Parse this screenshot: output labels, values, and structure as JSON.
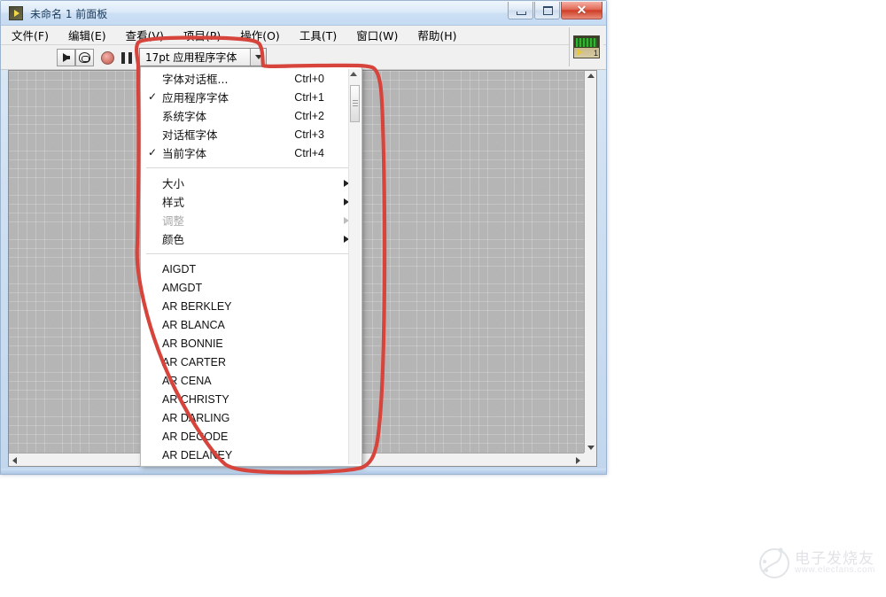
{
  "window": {
    "title": "未命名 1 前面板",
    "app_icon": "labview-vi-icon",
    "controls": {
      "minimize": "–",
      "maximize": "□",
      "close": "✕"
    }
  },
  "menubar": {
    "items": [
      {
        "label": "文件(F)",
        "name": "menu-file"
      },
      {
        "label": "编辑(E)",
        "name": "menu-edit"
      },
      {
        "label": "查看(V)",
        "name": "menu-view"
      },
      {
        "label": "项目(P)",
        "name": "menu-project"
      },
      {
        "label": "操作(O)",
        "name": "menu-operate"
      },
      {
        "label": "工具(T)",
        "name": "menu-tools"
      },
      {
        "label": "窗口(W)",
        "name": "menu-window"
      },
      {
        "label": "帮助(H)",
        "name": "menu-help"
      }
    ]
  },
  "toolbar": {
    "run_icon": "run-arrow-icon",
    "run_continuous_icon": "run-continuously-icon",
    "abort_icon": "abort-execution-icon",
    "pause_icon": "pause-icon",
    "font_combo_value": "17pt 应用程序字体",
    "align_icon": "align-objects-icon",
    "distribute_icon": "distribute-objects-icon",
    "resize_icon": "resize-objects-icon",
    "reorder_icon": "reorder-objects-icon",
    "help_icon": "context-help-icon",
    "vi_icon_number": "1"
  },
  "font_menu": {
    "commands": [
      {
        "label": "字体对话框...",
        "accel": "Ctrl+0",
        "checked": false,
        "disabled": false
      },
      {
        "label": "应用程序字体",
        "accel": "Ctrl+1",
        "checked": true,
        "disabled": false
      },
      {
        "label": "系统字体",
        "accel": "Ctrl+2",
        "checked": false,
        "disabled": false
      },
      {
        "label": "对话框字体",
        "accel": "Ctrl+3",
        "checked": false,
        "disabled": false
      },
      {
        "label": "当前字体",
        "accel": "Ctrl+4",
        "checked": true,
        "disabled": false
      }
    ],
    "submenus": [
      {
        "label": "大小",
        "disabled": false
      },
      {
        "label": "样式",
        "disabled": false
      },
      {
        "label": "调整",
        "disabled": true
      },
      {
        "label": "颜色",
        "disabled": false
      }
    ],
    "fonts": [
      "AIGDT",
      "AMGDT",
      "AR BERKLEY",
      "AR BLANCA",
      "AR BONNIE",
      "AR CARTER",
      "AR CENA",
      "AR CHRISTY",
      "AR DARLING",
      "AR DECODE",
      "AR DELANEY"
    ],
    "check_glyph": "✓",
    "submenu_arrow": "▶"
  },
  "canvas": {
    "scroll_up_icon": "scroll-up-arrow",
    "scroll_down_icon": "scroll-down-arrow",
    "scroll_left_icon": "scroll-left-arrow",
    "scroll_right_icon": "scroll-right-arrow"
  },
  "annotation": {
    "color": "#d6443c",
    "shape": "hand-drawn-circle-highlight"
  },
  "watermark": {
    "text": "电子发烧友",
    "url": "www.elecfans.com",
    "logo_icon": "elecfans-logo-icon"
  }
}
